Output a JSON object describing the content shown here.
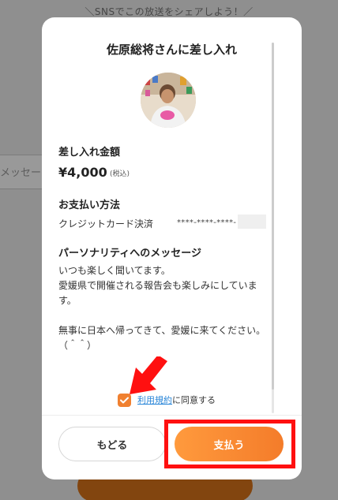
{
  "background": {
    "share_text": "＼SNSでこの放送をシェアしよう！／",
    "message_field_text": "メッセージ"
  },
  "modal": {
    "title": "佐原総将さんに差し入れ",
    "amount_label": "差し入れ金額",
    "amount": "¥4,000",
    "tax_note": "(税込)",
    "payment_label": "お支払い方法",
    "payment_method": "クレジットカード決済",
    "card_number": "****-****-****-",
    "message_label": "パーソナリティへのメッセージ",
    "message_body": "いつも楽しく聞いてます。\n愛媛県で開催される報告会も楽しみにしています。\n\n無事に日本へ帰ってきて、愛媛に来てください。\n（＾＾）",
    "terms_link": "利用規約",
    "terms_suffix": "に同意する",
    "terms_checked": true,
    "back_button": "もどる",
    "pay_button": "支払う"
  },
  "colors": {
    "accent_orange": "#f47c2a",
    "link_blue": "#2a86d8",
    "annotation_red": "#ff1010"
  },
  "icons": {
    "checkbox": "check-icon",
    "annotation_arrow": "arrow-down-left-icon"
  }
}
